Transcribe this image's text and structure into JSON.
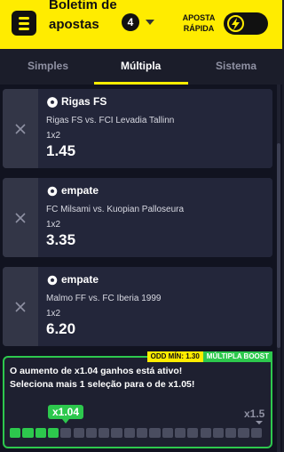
{
  "header": {
    "title": "Boletim de apostas",
    "bet_count": "4",
    "quick_bet_label": "APOSTA RÁPIDA",
    "brand_color": "#ffec00"
  },
  "tabs": [
    {
      "label": "Simples",
      "active": false
    },
    {
      "label": "Múltipla",
      "active": true
    },
    {
      "label": "Sistema",
      "active": false
    }
  ],
  "selections": [
    {
      "name": "Rigas FS",
      "match": "Rigas FS vs. FCI Levadia Tallinn",
      "market": "1x2",
      "odds": "1.45",
      "icon": "soccer-ball-icon"
    },
    {
      "name": "empate",
      "match": "FC Milsami vs. Kuopian Palloseura",
      "market": "1x2",
      "odds": "3.35",
      "icon": "soccer-ball-icon"
    },
    {
      "name": "empate",
      "match": "Malmo FF vs. FC Iberia 1999",
      "market": "1x2",
      "odds": "6.20",
      "icon": "soccer-ball-icon"
    }
  ],
  "boost": {
    "min_odds_label": "ODD MÍN: 1.30",
    "badge_label": "MÚLTIPLA BOOST",
    "line1": "O aumento de x1.04 ganhos está ativo!",
    "line2": "Seleciona mais 1 seleção para o de x1.05!",
    "current": "x1.04",
    "next": "x1.5",
    "progress_filled": 4,
    "progress_total": 20,
    "accent_color": "#2dc84d"
  }
}
